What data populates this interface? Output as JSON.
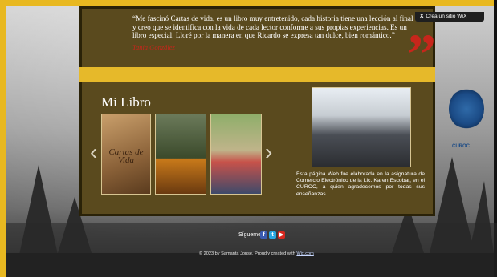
{
  "quote": {
    "text": "“Me fascinó Cartas de vida, es un libro muy entretenido, cada historia tiene una lección al final y creo que se identifica con la vida de cada lector conforme a sus propias experiencias. Es un libro especial. Lloré por la manera en que Ricardo se expresa tan dulce, bien romántico.”",
    "author": "Tania González",
    "mark": "”"
  },
  "section": {
    "title": "Mi Libro"
  },
  "gallery": {
    "book_title": "Cartas de Vida",
    "prev": "‹",
    "next": "›"
  },
  "note": "Esta página Web fue elaborada en la asignatura de Comercio Electrónico de la Lic. Karen Escobar, en el CUROC, a quien agradecemos por todas sus enseñanzas.",
  "side_logo": {
    "label": "CUROC"
  },
  "footer": {
    "follow": "Sígueme",
    "copyright_prefix": "© 2023 by Samanta Jonse. Proudly created with ",
    "copyright_link": "Wix.com"
  },
  "social": {
    "facebook": "f",
    "twitter": "t",
    "youtube": "▶"
  },
  "wix_badge": {
    "close": "X",
    "label": "Crea un sitio WiX"
  },
  "colors": {
    "brown": "#5a4a1e",
    "gold": "#e6b92a",
    "accent_red": "#c7261b"
  }
}
